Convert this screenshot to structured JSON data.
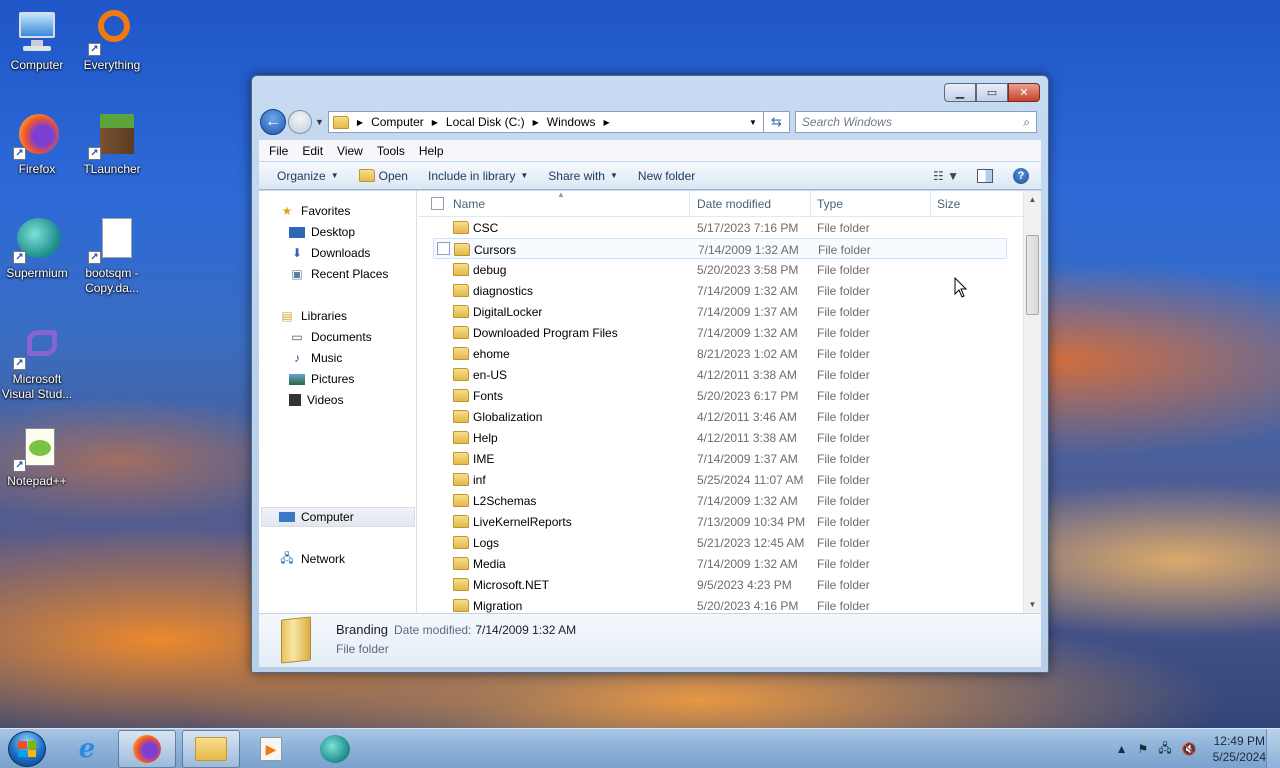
{
  "desktop": {
    "icons": [
      {
        "label": "Computer"
      },
      {
        "label": "Everything"
      },
      {
        "label": "Firefox"
      },
      {
        "label": "TLauncher"
      },
      {
        "label": "Supermium"
      },
      {
        "label": "bootsqm - Copy.da..."
      },
      {
        "label": "Microsoft Visual Stud..."
      },
      {
        "label": "Notepad++"
      }
    ]
  },
  "window": {
    "address": {
      "crumbs": [
        "Computer",
        "Local Disk (C:)",
        "Windows"
      ]
    },
    "search": {
      "placeholder": "Search Windows"
    },
    "menu": [
      "File",
      "Edit",
      "View",
      "Tools",
      "Help"
    ],
    "toolbar": {
      "organize": "Organize",
      "open": "Open",
      "include": "Include in library",
      "share": "Share with",
      "new_folder": "New folder"
    },
    "nav": {
      "favorites": "Favorites",
      "desktop": "Desktop",
      "downloads": "Downloads",
      "recent": "Recent Places",
      "libraries": "Libraries",
      "documents": "Documents",
      "music": "Music",
      "pictures": "Pictures",
      "videos": "Videos",
      "computer": "Computer",
      "network": "Network"
    },
    "columns": {
      "name": "Name",
      "date": "Date modified",
      "type": "Type",
      "size": "Size"
    },
    "rows": [
      {
        "name": "CSC",
        "date": "5/17/2023 7:16 PM",
        "type": "File folder"
      },
      {
        "name": "Cursors",
        "date": "7/14/2009 1:32 AM",
        "type": "File folder"
      },
      {
        "name": "debug",
        "date": "5/20/2023 3:58 PM",
        "type": "File folder"
      },
      {
        "name": "diagnostics",
        "date": "7/14/2009 1:32 AM",
        "type": "File folder"
      },
      {
        "name": "DigitalLocker",
        "date": "7/14/2009 1:37 AM",
        "type": "File folder"
      },
      {
        "name": "Downloaded Program Files",
        "date": "7/14/2009 1:32 AM",
        "type": "File folder"
      },
      {
        "name": "ehome",
        "date": "8/21/2023 1:02 AM",
        "type": "File folder"
      },
      {
        "name": "en-US",
        "date": "4/12/2011 3:38 AM",
        "type": "File folder"
      },
      {
        "name": "Fonts",
        "date": "5/20/2023 6:17 PM",
        "type": "File folder"
      },
      {
        "name": "Globalization",
        "date": "4/12/2011 3:46 AM",
        "type": "File folder"
      },
      {
        "name": "Help",
        "date": "4/12/2011 3:38 AM",
        "type": "File folder"
      },
      {
        "name": "IME",
        "date": "7/14/2009 1:37 AM",
        "type": "File folder"
      },
      {
        "name": "inf",
        "date": "5/25/2024 11:07 AM",
        "type": "File folder"
      },
      {
        "name": "L2Schemas",
        "date": "7/14/2009 1:32 AM",
        "type": "File folder"
      },
      {
        "name": "LiveKernelReports",
        "date": "7/13/2009 10:34 PM",
        "type": "File folder"
      },
      {
        "name": "Logs",
        "date": "5/21/2023 12:45 AM",
        "type": "File folder"
      },
      {
        "name": "Media",
        "date": "7/14/2009 1:32 AM",
        "type": "File folder"
      },
      {
        "name": "Microsoft.NET",
        "date": "9/5/2023 4:23 PM",
        "type": "File folder"
      },
      {
        "name": "Migration",
        "date": "5/20/2023 4:16 PM",
        "type": "File folder"
      }
    ],
    "details": {
      "name": "Branding",
      "date_label": "Date modified:",
      "date_value": "7/14/2009 1:32 AM",
      "type": "File folder"
    }
  },
  "taskbar": {
    "time": "12:49 PM",
    "date": "5/25/2024"
  },
  "colors": {
    "accent": "#1c58b0",
    "folder": "#e4b84a"
  }
}
